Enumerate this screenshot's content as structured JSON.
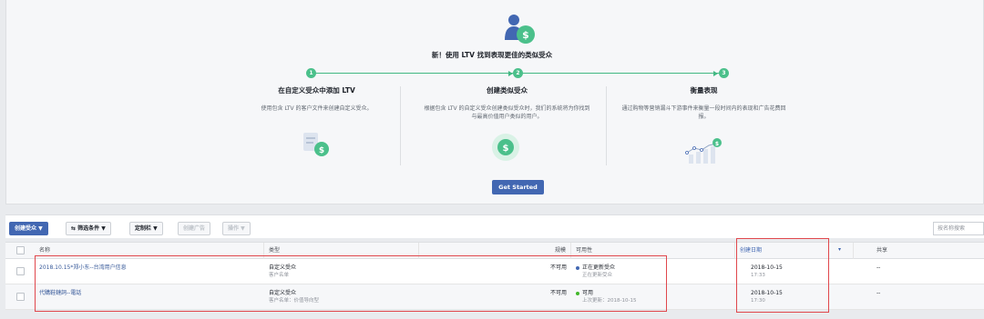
{
  "banner": {
    "headline": "新！使用 LTV 找到表现更佳的类似受众",
    "steps": [
      {
        "num": "1",
        "title": "在自定义受众中添加 LTV",
        "desc": "使用包含 LTV 的客户文件来创建自定义受众。"
      },
      {
        "num": "2",
        "title": "创建类似受众",
        "desc": "根据包含 LTV 的自定义受众创建类似受众时，我们的系统将为你找到与最高价值用户类似的用户。"
      },
      {
        "num": "3",
        "title": "衡量表现",
        "desc": "通过购物等营销漏斗下游事件来衡量一段时间内的表现和广告花费回报。"
      }
    ],
    "cta_label": "Get Started"
  },
  "toolbar": {
    "create_label": "创建受众 ▼",
    "filter_label": "⇆ 筛选条件 ▼",
    "columns_label": "定制栏 ▼",
    "create_ad_label": "创建广告",
    "actions_label": "操作 ▼",
    "search_placeholder": "按名称搜索"
  },
  "table": {
    "headers": {
      "name": "名称",
      "type": "类型",
      "size": "规模",
      "availability": "可用性",
      "created": "创建日期",
      "sort_icon": "▾",
      "share": "共享"
    },
    "rows": [
      {
        "name": "2018.10.15*郑小东--台湾用户信息",
        "type": "自定义受众",
        "type_sub": "客户名单",
        "size": "不可用",
        "status": "正在更新受众",
        "status_sub": "正在更新受众",
        "status_color": "#4267b2",
        "date": "2018-10-15",
        "time": "17:33",
        "share": "--"
      },
      {
        "name": "代購鞋鏈詞--電話",
        "type": "自定义受众",
        "type_sub": "客户名单：价值导向型",
        "size": "不可用",
        "status": "可用",
        "status_sub": "上次更新：2018-10-15",
        "status_color": "#42b72a",
        "date": "2018-10-15",
        "time": "17:30",
        "share": "--"
      }
    ]
  },
  "colors": {
    "accent": "#4267b2",
    "green": "#4bc08b",
    "highlight": "#e0474c"
  }
}
